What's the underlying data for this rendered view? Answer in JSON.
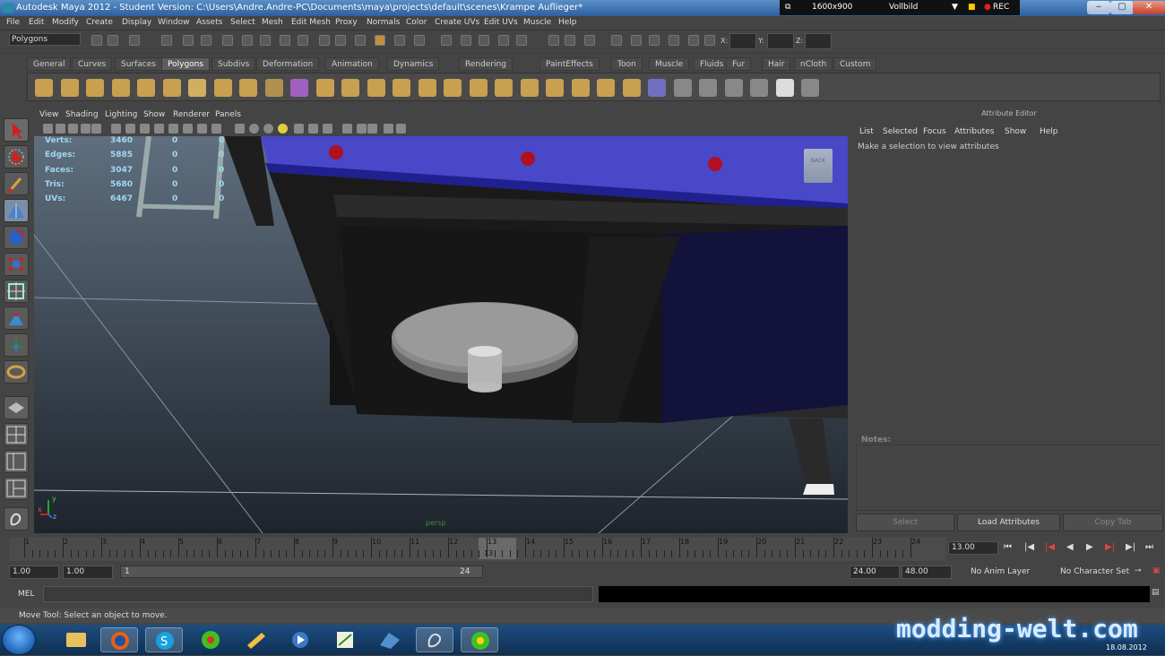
{
  "titlebar": {
    "title": "Autodesk Maya 2012 - Student Version: C:\\Users\\Andre.Andre-PC\\Documents\\maya\\projects\\default\\scenes\\Krampe Auflieger*"
  },
  "recorder": {
    "resolution": "1600x900",
    "mode": "Vollbild",
    "rec": "REC"
  },
  "window_buttons": {
    "minimize": "‒",
    "maximize": "▢",
    "close": "✕"
  },
  "menubar": [
    "File",
    "Edit",
    "Modify",
    "Create",
    "Display",
    "Window",
    "Assets",
    "Select",
    "Mesh",
    "Edit Mesh",
    "Proxy",
    "Normals",
    "Color",
    "Create UVs",
    "Edit UVs",
    "Muscle",
    "Help"
  ],
  "statusline": {
    "mode": "Polygons",
    "x_label": "X:",
    "y_label": "Y:",
    "z_label": "Z:"
  },
  "shelf_tabs": [
    "General",
    "Curves",
    "Surfaces",
    "Polygons",
    "Subdivs",
    "Deformation",
    "Animation",
    "Dynamics",
    "Rendering",
    "PaintEffects",
    "Toon",
    "Muscle",
    "Fluids",
    "Fur",
    "Hair",
    "nCloth",
    "Custom"
  ],
  "active_shelf": "Polygons",
  "viewport_menu": [
    "View",
    "Shading",
    "Lighting",
    "Show",
    "Renderer",
    "Panels"
  ],
  "hud": [
    {
      "label": "Verts:",
      "v1": "3460",
      "v2": "0",
      "v3": "0"
    },
    {
      "label": "Edges:",
      "v1": "5885",
      "v2": "0",
      "v3": "0"
    },
    {
      "label": "Faces:",
      "v1": "3047",
      "v2": "0",
      "v3": "0"
    },
    {
      "label": "Tris:",
      "v1": "5680",
      "v2": "0",
      "v3": "0"
    },
    {
      "label": "UVs:",
      "v1": "6467",
      "v2": "0",
      "v3": "0"
    }
  ],
  "view_cube": "BACK",
  "camera_label": "persp",
  "axis": {
    "x": "x",
    "y": "y",
    "z": "z"
  },
  "attribute_editor": {
    "title": "Attribute Editor",
    "menu": [
      "List",
      "Selected",
      "Focus",
      "Attributes",
      "Show",
      "Help"
    ],
    "hint": "Make a selection to view attributes",
    "notes_label": "Notes:",
    "buttons": {
      "select": "Select",
      "load": "Load Attributes",
      "copy": "Copy Tab"
    }
  },
  "timeline": {
    "ticks": [
      "1",
      "2",
      "3",
      "4",
      "5",
      "6",
      "7",
      "8",
      "9",
      "10",
      "11",
      "12",
      "13",
      "14",
      "15",
      "16",
      "17",
      "18",
      "19",
      "20",
      "21",
      "22",
      "23",
      "24"
    ],
    "current_frame": "13",
    "frame_field": "13.00"
  },
  "range": {
    "start": "1.00",
    "anim_start": "1.00",
    "slider_start": "1",
    "slider_end": "24",
    "end": "24.00",
    "anim_end": "48.00",
    "anim_layer": "No Anim Layer",
    "char_set": "No Character Set"
  },
  "command_line": {
    "label": "MEL"
  },
  "help_line": "Move Tool: Select an object to move.",
  "watermark": "modding-welt.com",
  "clock": {
    "date": "18.08.2012"
  },
  "colors": {
    "maya_bg": "#444444",
    "hud_text": "#a0d8f0",
    "deck": "#4a4ad0",
    "accent": "#5d5d5d"
  }
}
